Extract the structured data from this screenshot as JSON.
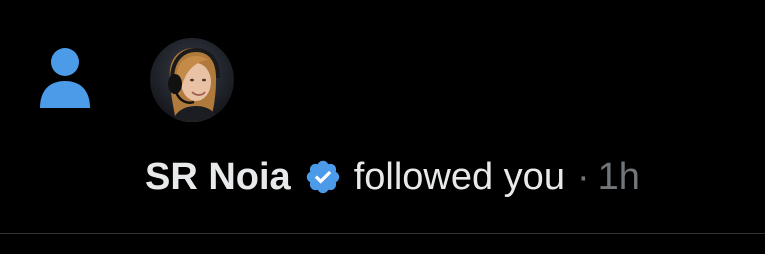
{
  "notification": {
    "icon": "person-icon",
    "avatar_icon": "user-avatar",
    "display_name": "SR Noia",
    "verified_icon": "verified-badge-icon",
    "action": "followed you",
    "separator": "·",
    "time": "1h"
  },
  "colors": {
    "background": "#000000",
    "accent": "#4c9be8",
    "text_primary": "#e7e9ea",
    "text_secondary": "#71767b",
    "divider": "#2f3336"
  }
}
